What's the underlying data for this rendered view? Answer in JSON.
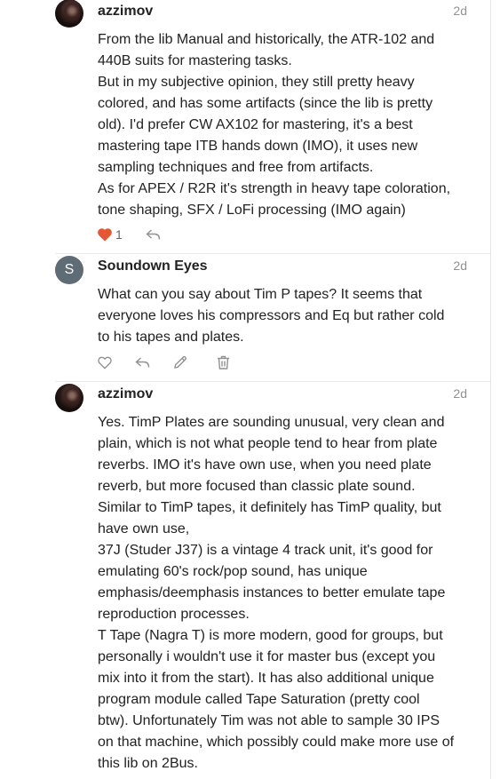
{
  "posts": [
    {
      "username": "azzimov",
      "date": "2d",
      "avatar": "user-photo",
      "lines": [
        "From the lib Manual and historically, the ATR-102 and",
        "440B suits for mastering tasks.",
        "But in my subjective opinion, they still pretty heavy",
        "colored, and has some artifacts (since the lib is pretty",
        "old). I'd prefer CW AX102 for mastering, it's a best",
        "mastering tape ITB hands down (IMO), it uses new",
        "sampling techniques and free from artifacts.",
        "As for APEX / R2R it's strength in heavy tape coloration,",
        "tone shaping, SFX / LoFi processing (IMO again)"
      ],
      "likes": "1"
    },
    {
      "username": "Soundown Eyes",
      "date": "2d",
      "avatar_letter": "S",
      "lines": [
        "What can you say about Tim P tapes? It seems that",
        "everyone loves his compressors and Eq but rather cold",
        "to his tapes and plates."
      ]
    },
    {
      "username": "azzimov",
      "date": "2d",
      "avatar": "user-photo",
      "lines": [
        "Yes. TimP Plates are sounding unusual, very clean and",
        "plain, which is not what people tend to hear from plate",
        "reverbs. IMO it's have own use, when you need plate",
        "reverb, but more focused than classic plate sound.",
        "Similar to TimP tapes, it definitely has TimP quality, but",
        "have own use,",
        "37J (Studer J37) is a vintage 4 track unit, it's good for",
        "emulating 60's rock/pop sound, has unique",
        "emphasis/deemphasis instances to better emulate tape",
        "reproduction processes.",
        "T Tape (Nagra T) is more modern, good for groups, but",
        "personally i wouldn't use it for master bus (except you",
        "mix into it from the start). It has also additional unique",
        "program module called Tape Saturation (pretty cool",
        "btw). Unfortunately Tim was not able to sample 30 IPS",
        "on that machine, which possibly could make more use of",
        "this lib on 2Bus."
      ]
    }
  ],
  "colors": {
    "text": "#222222",
    "muted": "#919191",
    "icon": "#919191",
    "liked": "#e45735",
    "avatar_letter_bg": "#5f6b75"
  },
  "icons": {
    "heart_filled": "heart-filled-icon",
    "heart_outline": "heart-outline-icon",
    "reply": "reply-icon",
    "edit": "pencil-icon",
    "delete": "trash-icon"
  }
}
